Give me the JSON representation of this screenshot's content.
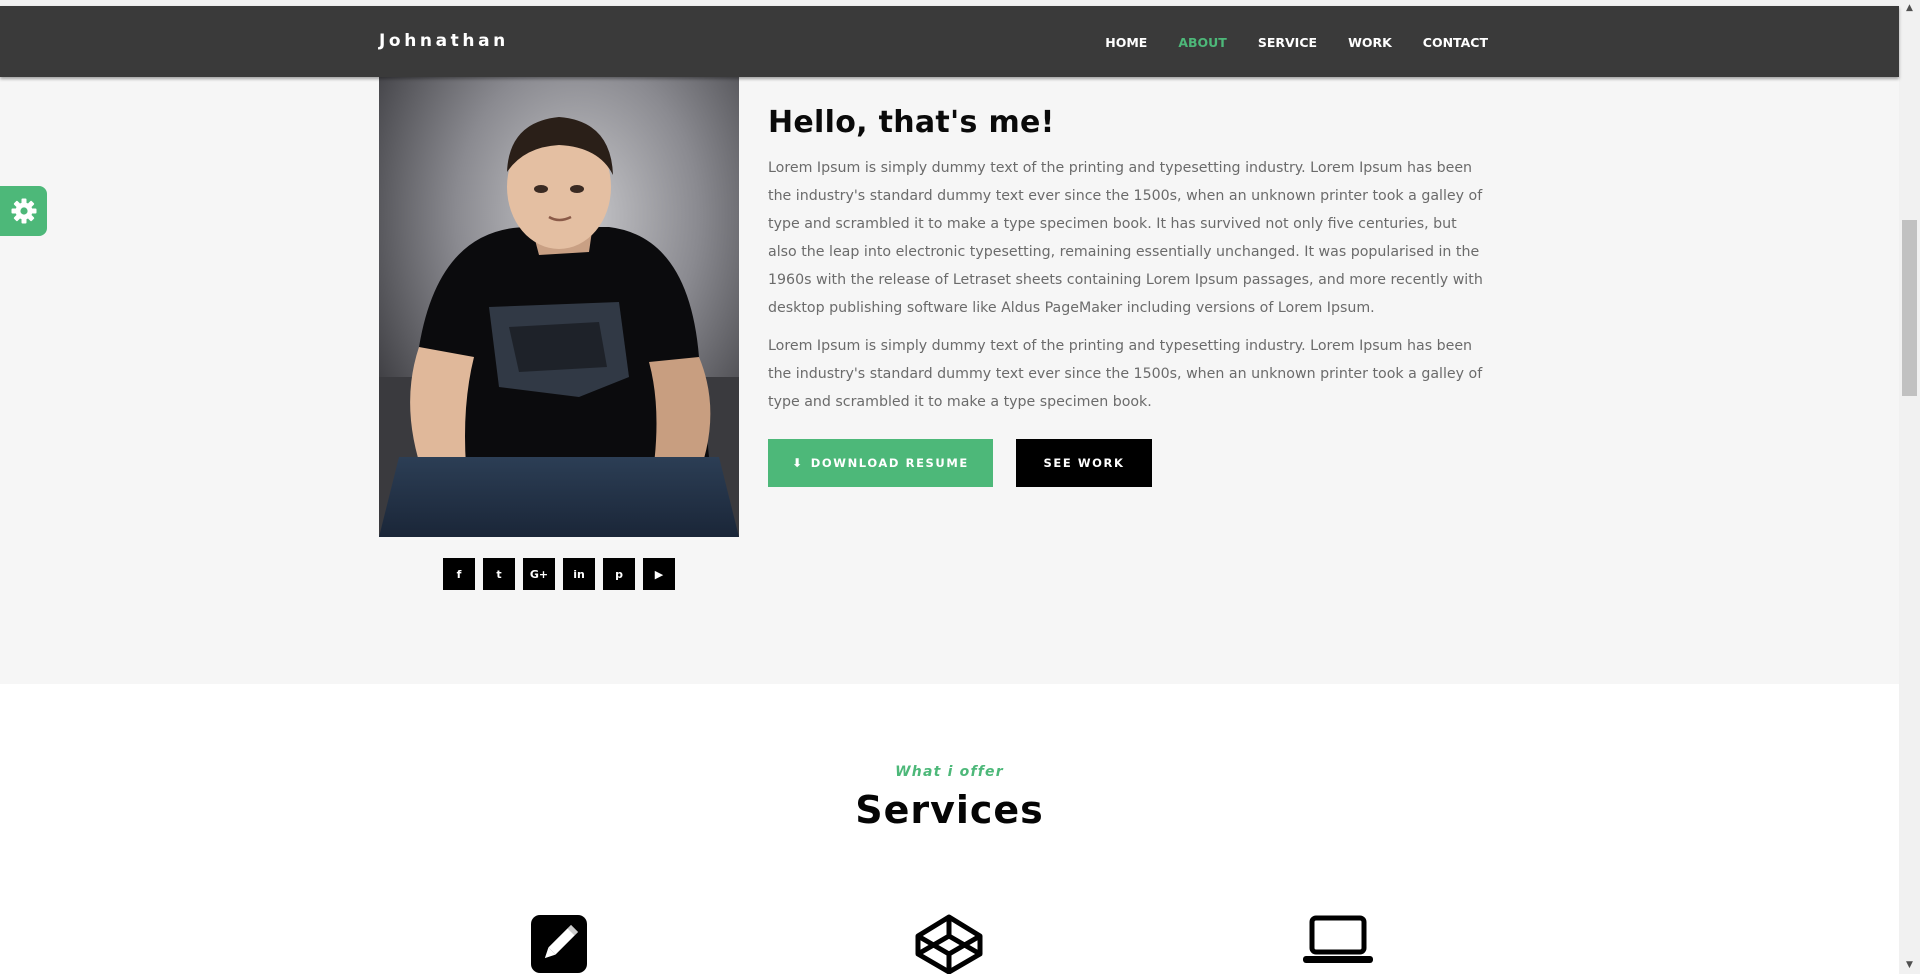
{
  "colors": {
    "accent": "#4db879",
    "navbar_bg": "#3a3a3a",
    "about_bg": "#f6f6f6"
  },
  "navbar": {
    "brand": "Johnathan",
    "items": [
      {
        "label": "HOME",
        "active": false
      },
      {
        "label": "ABOUT",
        "active": true
      },
      {
        "label": "SERVICE",
        "active": false
      },
      {
        "label": "WORK",
        "active": false
      },
      {
        "label": "CONTACT",
        "active": false
      }
    ]
  },
  "settings": {
    "icon": "gear-icon"
  },
  "about": {
    "heading": "Hello, that's me!",
    "paragraph1": "Lorem Ipsum is simply dummy text of the printing and typesetting industry. Lorem Ipsum has been the industry's standard dummy text ever since the 1500s, when an unknown printer took a galley of type and scrambled it to make a type specimen book. It has survived not only five centuries, but also the leap into electronic typesetting, remaining essentially unchanged. It was popularised in the 1960s with the release of Letraset sheets containing Lorem Ipsum passages, and more recently with desktop publishing software like Aldus PageMaker including versions of Lorem Ipsum.",
    "paragraph2": "Lorem Ipsum is simply dummy text of the printing and typesetting industry. Lorem Ipsum has been the industry's standard dummy text ever since the 1500s, when an unknown printer took a galley of type and scrambled it to make a type specimen book.",
    "download_label": "DOWNLOAD RESUME",
    "see_work_label": "SEE WORK",
    "socials": [
      {
        "glyph": "f",
        "icon": "facebook-icon"
      },
      {
        "glyph": "t",
        "icon": "twitter-icon"
      },
      {
        "glyph": "G+",
        "icon": "google-plus-icon"
      },
      {
        "glyph": "in",
        "icon": "linkedin-icon"
      },
      {
        "glyph": "p",
        "icon": "pinterest-icon"
      },
      {
        "glyph": "▶",
        "icon": "youtube-icon"
      }
    ]
  },
  "services": {
    "subtitle": "What i offer",
    "title": "Services",
    "icons": [
      "pencil-icon",
      "codepen-icon",
      "laptop-icon"
    ]
  }
}
